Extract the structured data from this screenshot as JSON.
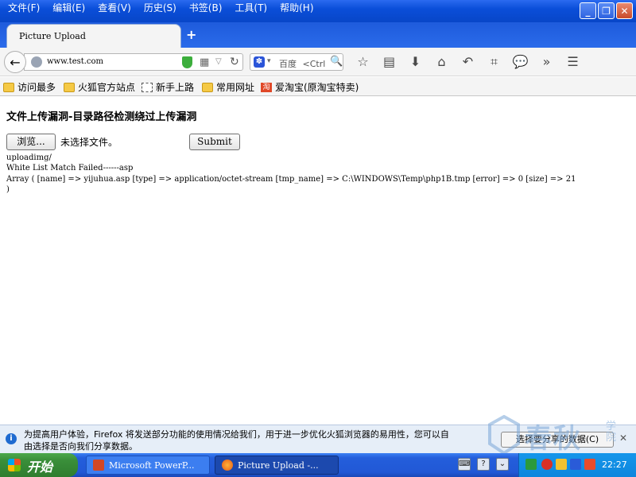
{
  "menubar": {
    "items": [
      "文件(F)",
      "编辑(E)",
      "查看(V)",
      "历史(S)",
      "书签(B)",
      "工具(T)",
      "帮助(H)"
    ]
  },
  "tab": {
    "title": "Picture Upload",
    "new_tab": "+"
  },
  "navbar": {
    "url": "www.test.com",
    "search_engine": "百度",
    "search_placeholder": "<Ctrl"
  },
  "bookmarks": {
    "items": [
      "访问最多",
      "火狐官方站点",
      "新手上路",
      "常用网址",
      "爱淘宝(原淘宝特卖)"
    ]
  },
  "page": {
    "heading": "文件上传漏洞-目录路径检测绕过上传漏洞",
    "browse_label": "浏览...",
    "no_file_text": "未选择文件。",
    "submit_label": "Submit",
    "output_lines": [
      "uploadimg/",
      "White List Match Failed------asp",
      "Array ( [name] => yijuhua.asp [type] => application/octet-stream [tmp_name] => C:\\WINDOWS\\Temp\\php1B.tmp [error] => 0 [size] => 21",
      ")"
    ]
  },
  "notification": {
    "line1": "为提高用户体验，Firefox 将发送部分功能的使用情况给我们，用于进一步优化火狐浏览器的易用性，您可以自",
    "line2": "由选择是否向我们分享数据。",
    "share_button": "选择要分享的数据(C)"
  },
  "watermark": {
    "text": "春秋",
    "side_text": "学院"
  },
  "taskbar": {
    "start_label": "开始",
    "tasks": [
      "Microsoft PowerP...",
      "Picture Upload -..."
    ],
    "clock": "22:27"
  },
  "colors": {
    "titlebar": "#0a4ed8",
    "taskbar": "#245edb",
    "start": "#3a8f3a",
    "notification_bg": "#e6eef8"
  }
}
